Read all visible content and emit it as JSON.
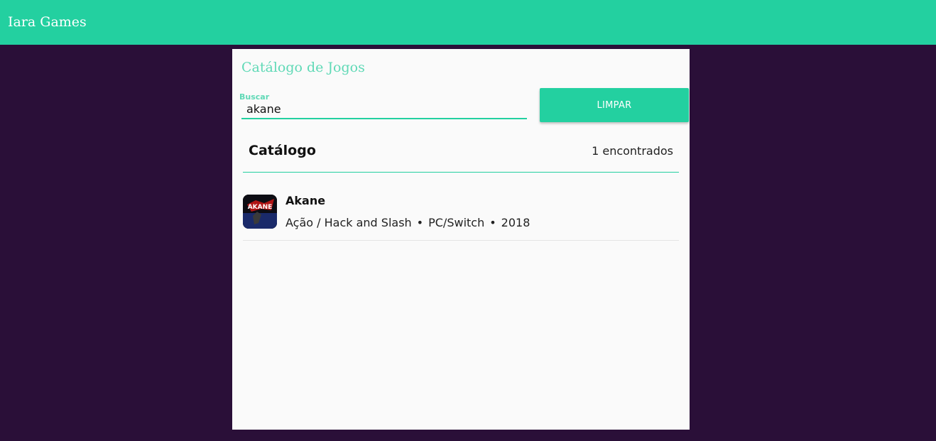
{
  "app": {
    "title": "Iara Games"
  },
  "panel": {
    "title": "Catálogo de Jogos",
    "search": {
      "label": "Buscar",
      "value": "akane"
    },
    "clear_button": "LIMPAR"
  },
  "catalog": {
    "title": "Catálogo",
    "count": "1 encontrados",
    "items": [
      {
        "name": "Akane",
        "genre": "Ação / Hack and Slash",
        "platform": "PC/Switch",
        "year": "2018",
        "separator": "•",
        "icon_text": "AKANE"
      }
    ]
  },
  "colors": {
    "accent": "#23d0a0",
    "accent_light": "#5fd9b6",
    "background": "#2a0f38",
    "panel": "#fafafa"
  }
}
